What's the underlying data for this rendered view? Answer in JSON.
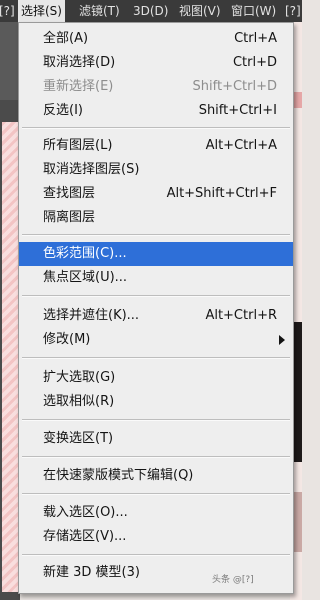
{
  "menubar": {
    "items": [
      {
        "label": "[?]"
      },
      {
        "label": "选择(S)"
      },
      {
        "label": "滤镜(T)"
      },
      {
        "label": "3D(D)"
      },
      {
        "label": "视图(V)"
      },
      {
        "label": "窗口(W)"
      },
      {
        "label": "[?]"
      }
    ]
  },
  "menu": {
    "items": [
      {
        "label": "全部(A)",
        "shortcut": "Ctrl+A"
      },
      {
        "label": "取消选择(D)",
        "shortcut": "Ctrl+D"
      },
      {
        "label": "重新选择(E)",
        "shortcut": "Shift+Ctrl+D",
        "disabled": true
      },
      {
        "label": "反选(I)",
        "shortcut": "Shift+Ctrl+I"
      },
      {
        "label": "所有图层(L)",
        "shortcut": "Alt+Ctrl+A"
      },
      {
        "label": "取消选择图层(S)",
        "shortcut": ""
      },
      {
        "label": "查找图层",
        "shortcut": "Alt+Shift+Ctrl+F"
      },
      {
        "label": "隔离图层",
        "shortcut": ""
      },
      {
        "label": "色彩范围(C)...",
        "shortcut": "",
        "highlighted": true
      },
      {
        "label": "焦点区域(U)...",
        "shortcut": ""
      },
      {
        "label": "选择并遮住(K)...",
        "shortcut": "Alt+Ctrl+R"
      },
      {
        "label": "修改(M)",
        "shortcut": "",
        "submenu": true
      },
      {
        "label": "扩大选取(G)",
        "shortcut": ""
      },
      {
        "label": "选取相似(R)",
        "shortcut": ""
      },
      {
        "label": "变换选区(T)",
        "shortcut": ""
      },
      {
        "label": "在快速蒙版模式下编辑(Q)",
        "shortcut": ""
      },
      {
        "label": "载入选区(O)...",
        "shortcut": ""
      },
      {
        "label": "存储选区(V)...",
        "shortcut": ""
      },
      {
        "label": "新建 3D 模型(3)",
        "shortcut": ""
      }
    ]
  },
  "watermark": "头条 @[?]",
  "colors": {
    "menubar_bg": "#3a3a3a",
    "menu_bg": "#eeeeee",
    "highlight": "#2e6fd8",
    "disabled_text": "#8d8d8d"
  }
}
